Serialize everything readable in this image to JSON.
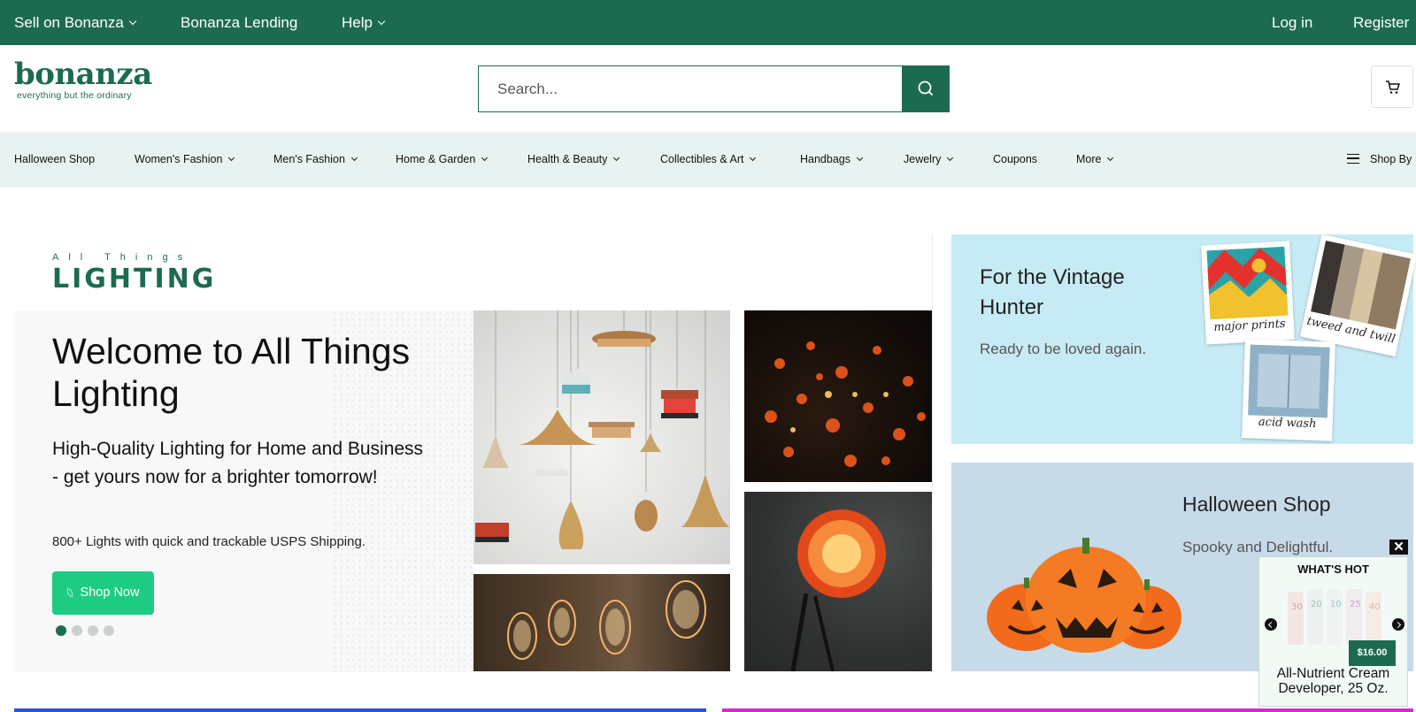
{
  "topbar": {
    "sell_label": "Sell on Bonanza",
    "lending_label": "Bonanza Lending",
    "help_label": "Help",
    "login_label": "Log in",
    "register_label": "Register"
  },
  "header": {
    "logo_text": "bonanza",
    "logo_tagline": "everything but the ordinary",
    "search_placeholder": "Search..."
  },
  "categories": {
    "halloween": "Halloween Shop",
    "womens": "Women's Fashion",
    "mens": "Men's Fashion",
    "home": "Home & Garden",
    "health": "Health & Beauty",
    "collectibles": "Collectibles & Art",
    "handbags": "Handbags",
    "jewelry": "Jewelry",
    "coupons": "Coupons",
    "more": "More",
    "shop_by": "Shop By"
  },
  "hero": {
    "brand_small": "All Things",
    "brand_big": "LIGHTING",
    "title": "Welcome to All Things Lighting",
    "subtitle": "High-Quality Lighting for Home and Business - get yours now for a brighter tomorrow!",
    "small_text": "800+ Lights with quick and trackable USPS Shipping.",
    "cta_label": "Shop Now",
    "slide_count": 4,
    "active_slide": 1
  },
  "promos": {
    "vintage_title": "For the Vintage Hunter",
    "vintage_sub": "Ready to be loved again.",
    "vintage_captions": [
      "major prints",
      "tweed and twill",
      "acid wash"
    ],
    "halloween_title": "Halloween Shop",
    "halloween_sub": "Spooky and Delightful."
  },
  "whats_hot": {
    "title": "WHAT'S HOT",
    "price": "$16.00",
    "product_name": "All-Nutrient Cream Developer, 25 Oz.",
    "close_label": "✕"
  },
  "colors": {
    "brand_green": "#1c6b51",
    "cta_green": "#1ecb82",
    "category_bg": "#e8f3f1",
    "vintage_bg": "#c6ebf5",
    "halloween_bg": "#c7dae8",
    "pumpkin": "#f26a1b"
  }
}
